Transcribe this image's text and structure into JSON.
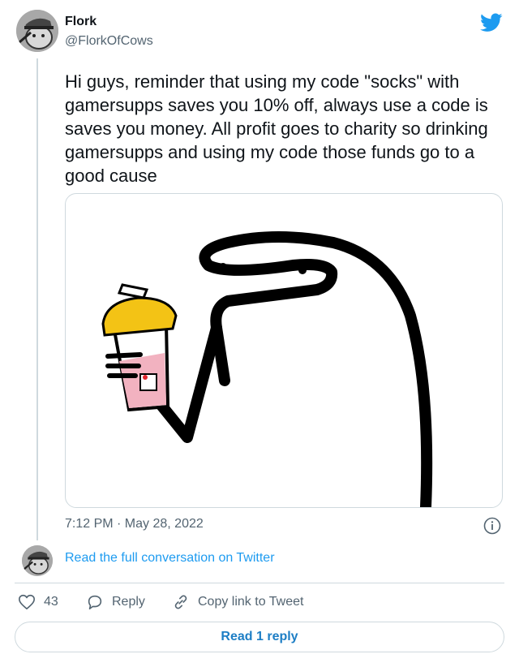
{
  "author": {
    "name": "Flork",
    "handle": "@FlorkOfCows"
  },
  "tweet": {
    "text": "Hi guys, reminder that using my code \"socks\" with gamersupps saves you 10% off, always use a code is saves you money. All profit goes to charity so drinking gamersupps and using my code those funds go to a good cause",
    "timestamp": "7:12 PM · May 28, 2022"
  },
  "links": {
    "read_conversation": "Read the full conversation on Twitter"
  },
  "actions": {
    "like_count": "43",
    "reply_label": "Reply",
    "copy_link_label": "Copy link to Tweet"
  },
  "footer": {
    "read_replies": "Read 1 reply"
  },
  "icons": {
    "brand": "twitter-bird-icon",
    "info": "info-icon",
    "like": "heart-icon",
    "reply": "speech-bubble-icon",
    "copy": "link-icon"
  },
  "colors": {
    "accent": "#1d9bf0",
    "text": "#0f1419",
    "secondary": "#536471",
    "border": "#cfd9de"
  }
}
